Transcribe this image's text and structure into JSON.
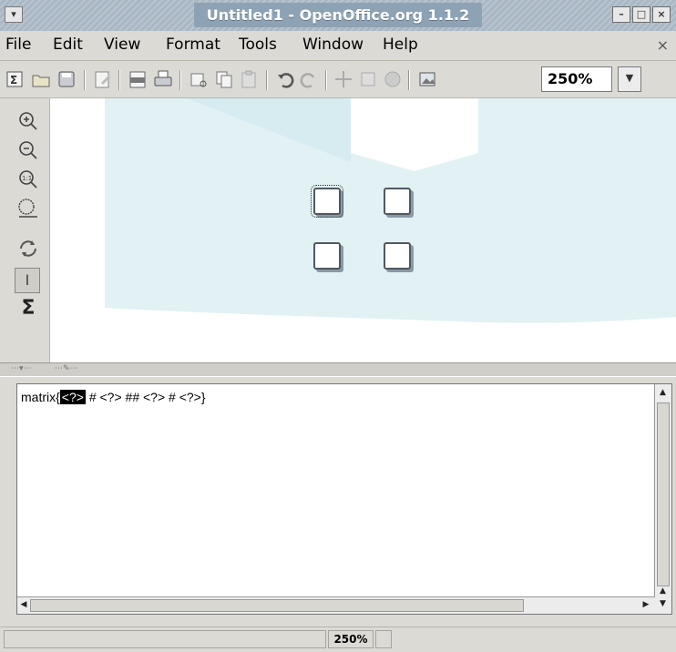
{
  "window": {
    "title": "Untitled1 - OpenOffice.org 1.1.2",
    "controls": [
      "minimize",
      "maximize",
      "close"
    ]
  },
  "menubar": {
    "items": [
      {
        "label": "File"
      },
      {
        "label": "Edit"
      },
      {
        "label": "View"
      },
      {
        "label": "Format"
      },
      {
        "label": "Tools"
      },
      {
        "label": "Window"
      },
      {
        "label": "Help"
      }
    ],
    "close_glyph": "×"
  },
  "toolbar": {
    "icons": [
      "new-formula-icon",
      "open-folder-icon",
      "save-icon",
      "edit-file-icon",
      "export-pdf-icon",
      "print-icon",
      "cut-icon",
      "copy-icon",
      "paste-icon",
      "undo-icon",
      "redo-icon",
      "navigator-icon",
      "gallery-icon",
      "data-sources-icon",
      "insert-image-icon"
    ],
    "zoom_value": "250%"
  },
  "lefttools": {
    "icons": [
      "zoom-in-icon",
      "zoom-out-icon",
      "zoom-100-icon",
      "show-all-icon",
      "refresh-icon",
      "formula-cursor-icon",
      "selection-sigma-icon"
    ]
  },
  "formula": {
    "prefix": "matrix{",
    "selected": "<?>",
    "rest": " # <?> ## <?> # <?>}"
  },
  "statusbar": {
    "zoom": "250%"
  }
}
